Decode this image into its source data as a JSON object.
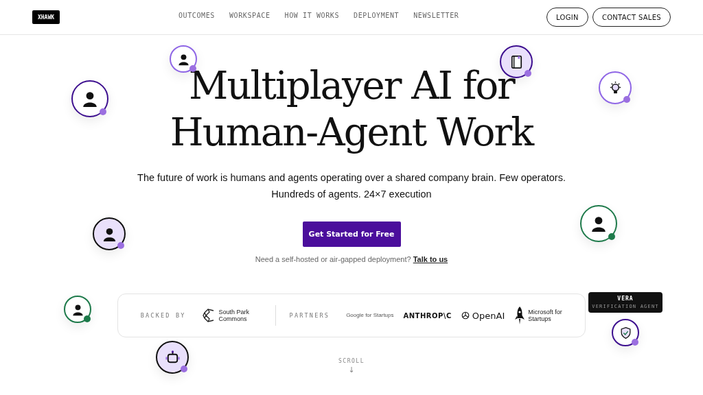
{
  "header": {
    "logo": "XHAWK",
    "nav": [
      "OUTCOMES",
      "WORKSPACE",
      "HOW IT WORKS",
      "DEPLOYMENT",
      "NEWSLETTER"
    ],
    "buttons": [
      {
        "label": "LOGIN"
      },
      {
        "label": "CONTACT SALES"
      }
    ]
  },
  "hero": {
    "title": [
      "Multiplayer AI for",
      "Human-Agent Work"
    ],
    "subtitle": [
      "The future of work is humans and agents operating over a shared company brain. Few operators.",
      "Hundreds of agents. 24×7 execution"
    ],
    "cta": "Get Started for Free",
    "note": "Need a self-hosted or air-gapped deployment?",
    "note_link": "Talk to us"
  },
  "avatars": [
    {
      "kind": "person",
      "color": "#8f66e6",
      "filled": false,
      "dot": {
        "color": "#9b6fe0"
      }
    },
    {
      "kind": "person",
      "color": "#3d0f8f",
      "filled": false,
      "dot": {
        "color": "#9b6fe0"
      }
    },
    {
      "kind": "person",
      "color": "#111111",
      "filled": true,
      "dot": {
        "color": "#9b6fe0"
      }
    },
    {
      "kind": "book",
      "color": "#3d0f8f",
      "filled": true,
      "dot": {
        "color": "#9b6fe0"
      }
    },
    {
      "kind": "bulb",
      "color": "#8f66e6",
      "filled": false,
      "dot": {
        "color": "#9b6fe0"
      }
    },
    {
      "kind": "person",
      "color": "#1d7a4a",
      "filled": false,
      "dot": {
        "color": "#1d7a4a"
      }
    },
    {
      "kind": "person",
      "color": "#1d7a4a",
      "filled": false,
      "dot": {
        "color": "#1d7a4a"
      }
    },
    {
      "kind": "robot",
      "color": "#111111",
      "filled": true,
      "dot": {
        "color": "#9b6fe0"
      }
    },
    {
      "kind": "shield",
      "color": "#3d0f8f",
      "filled": false,
      "dot": {
        "color": "#9b6fe0"
      },
      "tooltip": {
        "title": "VERA",
        "subtitle": "VERIFICATION AGENT"
      }
    }
  ],
  "backers": {
    "backed_label": "BACKED BY",
    "backed": [
      {
        "kind": "mark",
        "name": "South Park Commons"
      }
    ],
    "partners_label": "PARTNERS",
    "partners": [
      {
        "kind": "plain",
        "name": "Google for Startups"
      },
      {
        "kind": "bold",
        "name": "ANTHROP\\C"
      },
      {
        "kind": "mark",
        "name": "OpenAI"
      },
      {
        "kind": "mark",
        "name": "Microsoft for Startups"
      }
    ]
  },
  "scroll": {
    "label": "SCROLL",
    "arrow": "↓"
  }
}
